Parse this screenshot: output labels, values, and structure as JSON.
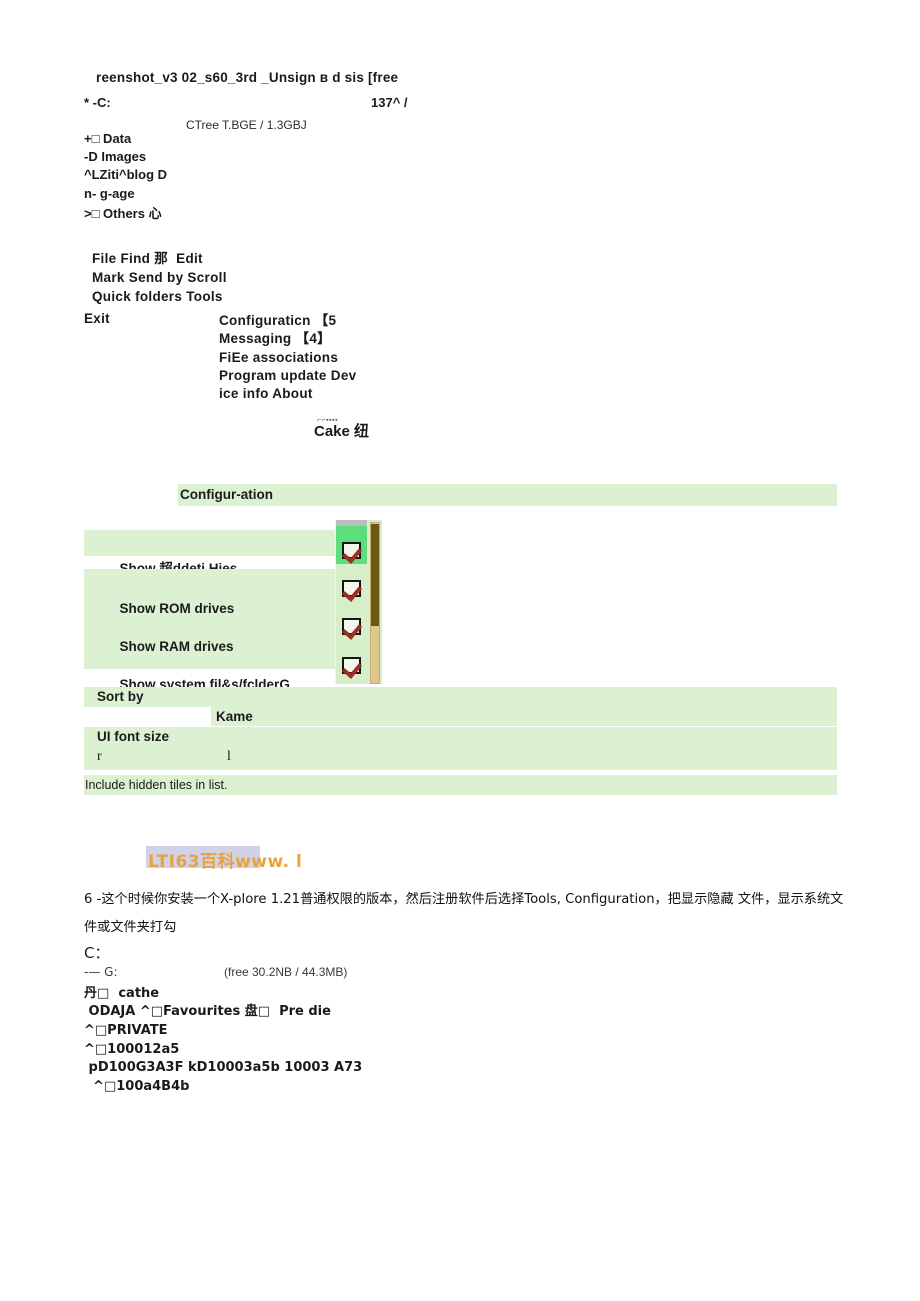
{
  "screenshot": {
    "title": "reenshot_v3 02_s60_3rd _Unsign в d sis [free",
    "drive_line": "* -C:",
    "drive_size": "137^ /",
    "tree_size": "CTree T.BGE / 1.3GBJ",
    "tree_items": [
      "+□ Data",
      "-D Images",
      "^LZiti^blog D",
      "n- g-age",
      ">□ Others 心"
    ]
  },
  "menu": {
    "lines": [
      "File Find 那  Edit",
      "Mark Send by Scroll",
      "Quick folders Tools"
    ],
    "exit": "Exit",
    "submenu": [
      "Configuraticn 【5",
      "Messaging 【4】",
      "FiEe associations",
      "Program update Dev",
      "ice info About"
    ]
  },
  "cake_caption": {
    "dots": "⌐⌐▪▪▪▪",
    "text": "Cake 纽"
  },
  "config": {
    "header": "Configur-ation",
    "options": [
      {
        "label": "Show 超ddeti Hies",
        "checked": true
      },
      {
        "label": "Show ROM drives",
        "checked": true
      },
      {
        "label": "Show RAM drives",
        "checked": true
      },
      {
        "label": "Show system fil&s/fclderG",
        "checked": true
      }
    ],
    "sort_by_label": "Sort by",
    "sort_by_value": "Kame",
    "font_size_label": "UI font size",
    "font_size_left": "r",
    "font_size_right": "l",
    "hint": "Include hidden tiles in list."
  },
  "watermark": {
    "text": "LTI63百科www. l",
    "color": "#e8a33d",
    "background": "#c9c9e4"
  },
  "paragraph": {
    "text": "6 -这个时候你安装一个X-plore 1.21普通权限的版本，然后注册软件后选择Tools, Configuration，把显示隐藏 文件，显示系统文件或文件夹打勾"
  },
  "listing": {
    "root": "C：",
    "drive_prefix": "-— G:",
    "drive_free": "(free 30.2NB / 44.3MB)",
    "rows": [
      "丹□  cathe",
      " ODAJA ^□Favourites 盘□  Pre die",
      "^□PRIVATE",
      "^□100012a5",
      " pD100G3A3F kD10003a5b 10003 A73",
      "  ^□100a4B4b"
    ]
  },
  "colors": {
    "green_row": "#dcf0d2",
    "green_row_alt": "#d7eeca",
    "checkbox_highlight": "#5ddd7e",
    "check_mark": "#9c2f20",
    "scrollbar_track": "#dfc68c",
    "scrollbar_thumb": "#6b5a13"
  }
}
